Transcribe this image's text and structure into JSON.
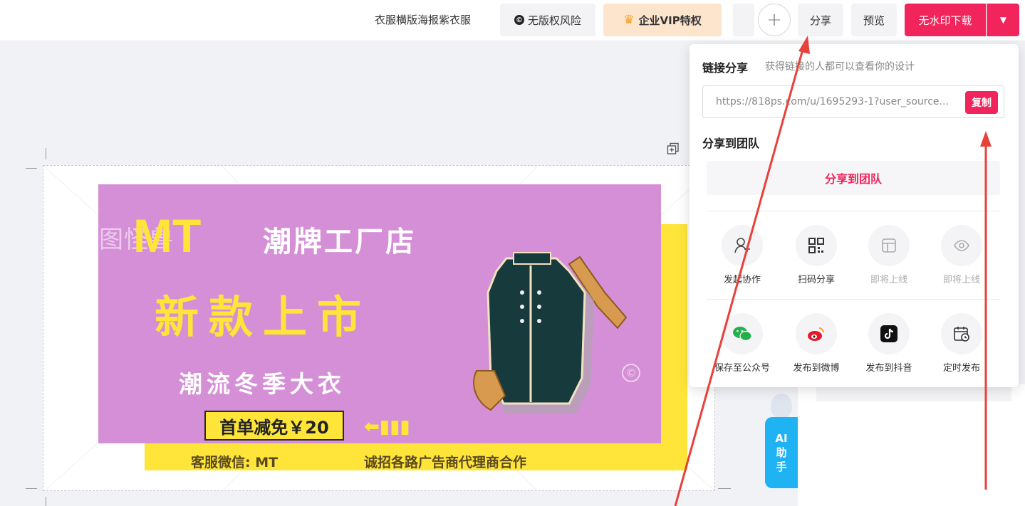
{
  "header": {
    "doc_title": "衣服横版海报紫衣服",
    "copyright_label": "无版权风险",
    "copyright_icon": "copyright-icon",
    "vip_label": "企业VIP特权",
    "vip_icon": "crown-icon",
    "add_icon": "plus-icon",
    "share_label": "分享",
    "preview_label": "预览",
    "download_label": "无水印下载",
    "download_menu_icon": "caret-down-icon"
  },
  "poster": {
    "brand": "MT",
    "shop_name": "潮牌工厂店",
    "watermark": "图怪兽",
    "headline": "新款上市",
    "subline": "潮流冬季大衣",
    "badge": "首单减免￥20",
    "wechat": "客服微信: MT",
    "recruit": "诚招各路广告商代理商合作"
  },
  "ai_helper": {
    "label_line1": "AI",
    "label_line2": "助",
    "label_line3": "手"
  },
  "share_popup": {
    "link_title": "链接分享",
    "link_desc": "获得链接的人都可以查看你的设计",
    "link_url": "https://818ps.com/u/1695293-1?user_source...",
    "copy_label": "复制",
    "team_title": "分享到团队",
    "team_button": "分享到团队",
    "row1": [
      {
        "label": "发起协作",
        "icon": "collaborate-icon"
      },
      {
        "label": "扫码分享",
        "icon": "qrcode-icon"
      },
      {
        "label": "即将上线",
        "icon": "layout-icon"
      },
      {
        "label": "即将上线",
        "icon": "eye-icon"
      }
    ],
    "row2": [
      {
        "label": "保存至公众号",
        "icon": "wechat-icon"
      },
      {
        "label": "发布到微博",
        "icon": "weibo-icon"
      },
      {
        "label": "发布到抖音",
        "icon": "douyin-icon"
      },
      {
        "label": "定时发布",
        "icon": "calendar-icon"
      }
    ]
  },
  "colors": {
    "accent": "#f1245c",
    "vip_bg": "#fde4cc",
    "poster_purple": "#d58fd6",
    "poster_yellow": "#ffe539",
    "annotation_red": "#e8403a"
  }
}
